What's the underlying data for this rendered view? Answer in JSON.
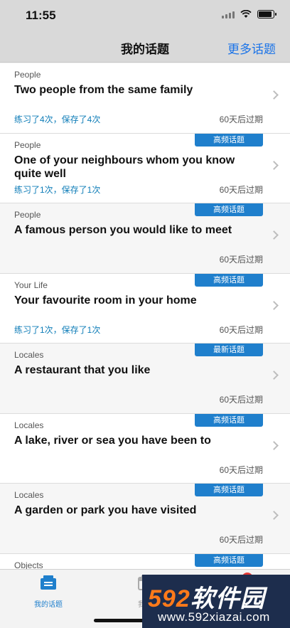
{
  "status": {
    "time": "11:55"
  },
  "nav": {
    "title": "我的话题",
    "more": "更多话题"
  },
  "topics": [
    {
      "category": "People",
      "title": "Two people from the same family",
      "practice": "练习了4次，保存了4次",
      "expire": "60天后过期",
      "badge": ""
    },
    {
      "category": "People",
      "title": "One of your neighbours whom you know quite well",
      "practice": "练习了1次，保存了1次",
      "expire": "60天后过期",
      "badge": "高频话题"
    },
    {
      "category": "People",
      "title": "A famous person you would like to meet",
      "practice": "",
      "expire": "60天后过期",
      "badge": "高频话题"
    },
    {
      "category": "Your Life",
      "title": "Your favourite room in your home",
      "practice": "练习了1次，保存了1次",
      "expire": "60天后过期",
      "badge": "高频话题"
    },
    {
      "category": "Locales",
      "title": "A restaurant that you like",
      "practice": "",
      "expire": "60天后过期",
      "badge": "最新话题"
    },
    {
      "category": "Locales",
      "title": "A lake, river or sea you have been to",
      "practice": "",
      "expire": "60天后过期",
      "badge": "高频话题"
    },
    {
      "category": "Locales",
      "title": "A garden or park you have visited",
      "practice": "",
      "expire": "60天后过期",
      "badge": "高频话题"
    },
    {
      "category": "Objects",
      "title": "",
      "practice": "",
      "expire": "",
      "badge": "高频话题"
    }
  ],
  "tabs": [
    {
      "label": "我的话题",
      "icon": "topics-icon",
      "active": true
    },
    {
      "label": "我的",
      "icon": "calendar-icon",
      "active": false
    },
    {
      "label": "",
      "icon": "profile-icon",
      "active": false,
      "badge": "2"
    }
  ],
  "watermark": {
    "brand_num": "592",
    "brand_text": "软件园",
    "url": "www.592xiazai.com"
  },
  "colors": {
    "accent": "#1f7fcc",
    "link": "#1a73e8",
    "practice": "#0f7db8"
  }
}
